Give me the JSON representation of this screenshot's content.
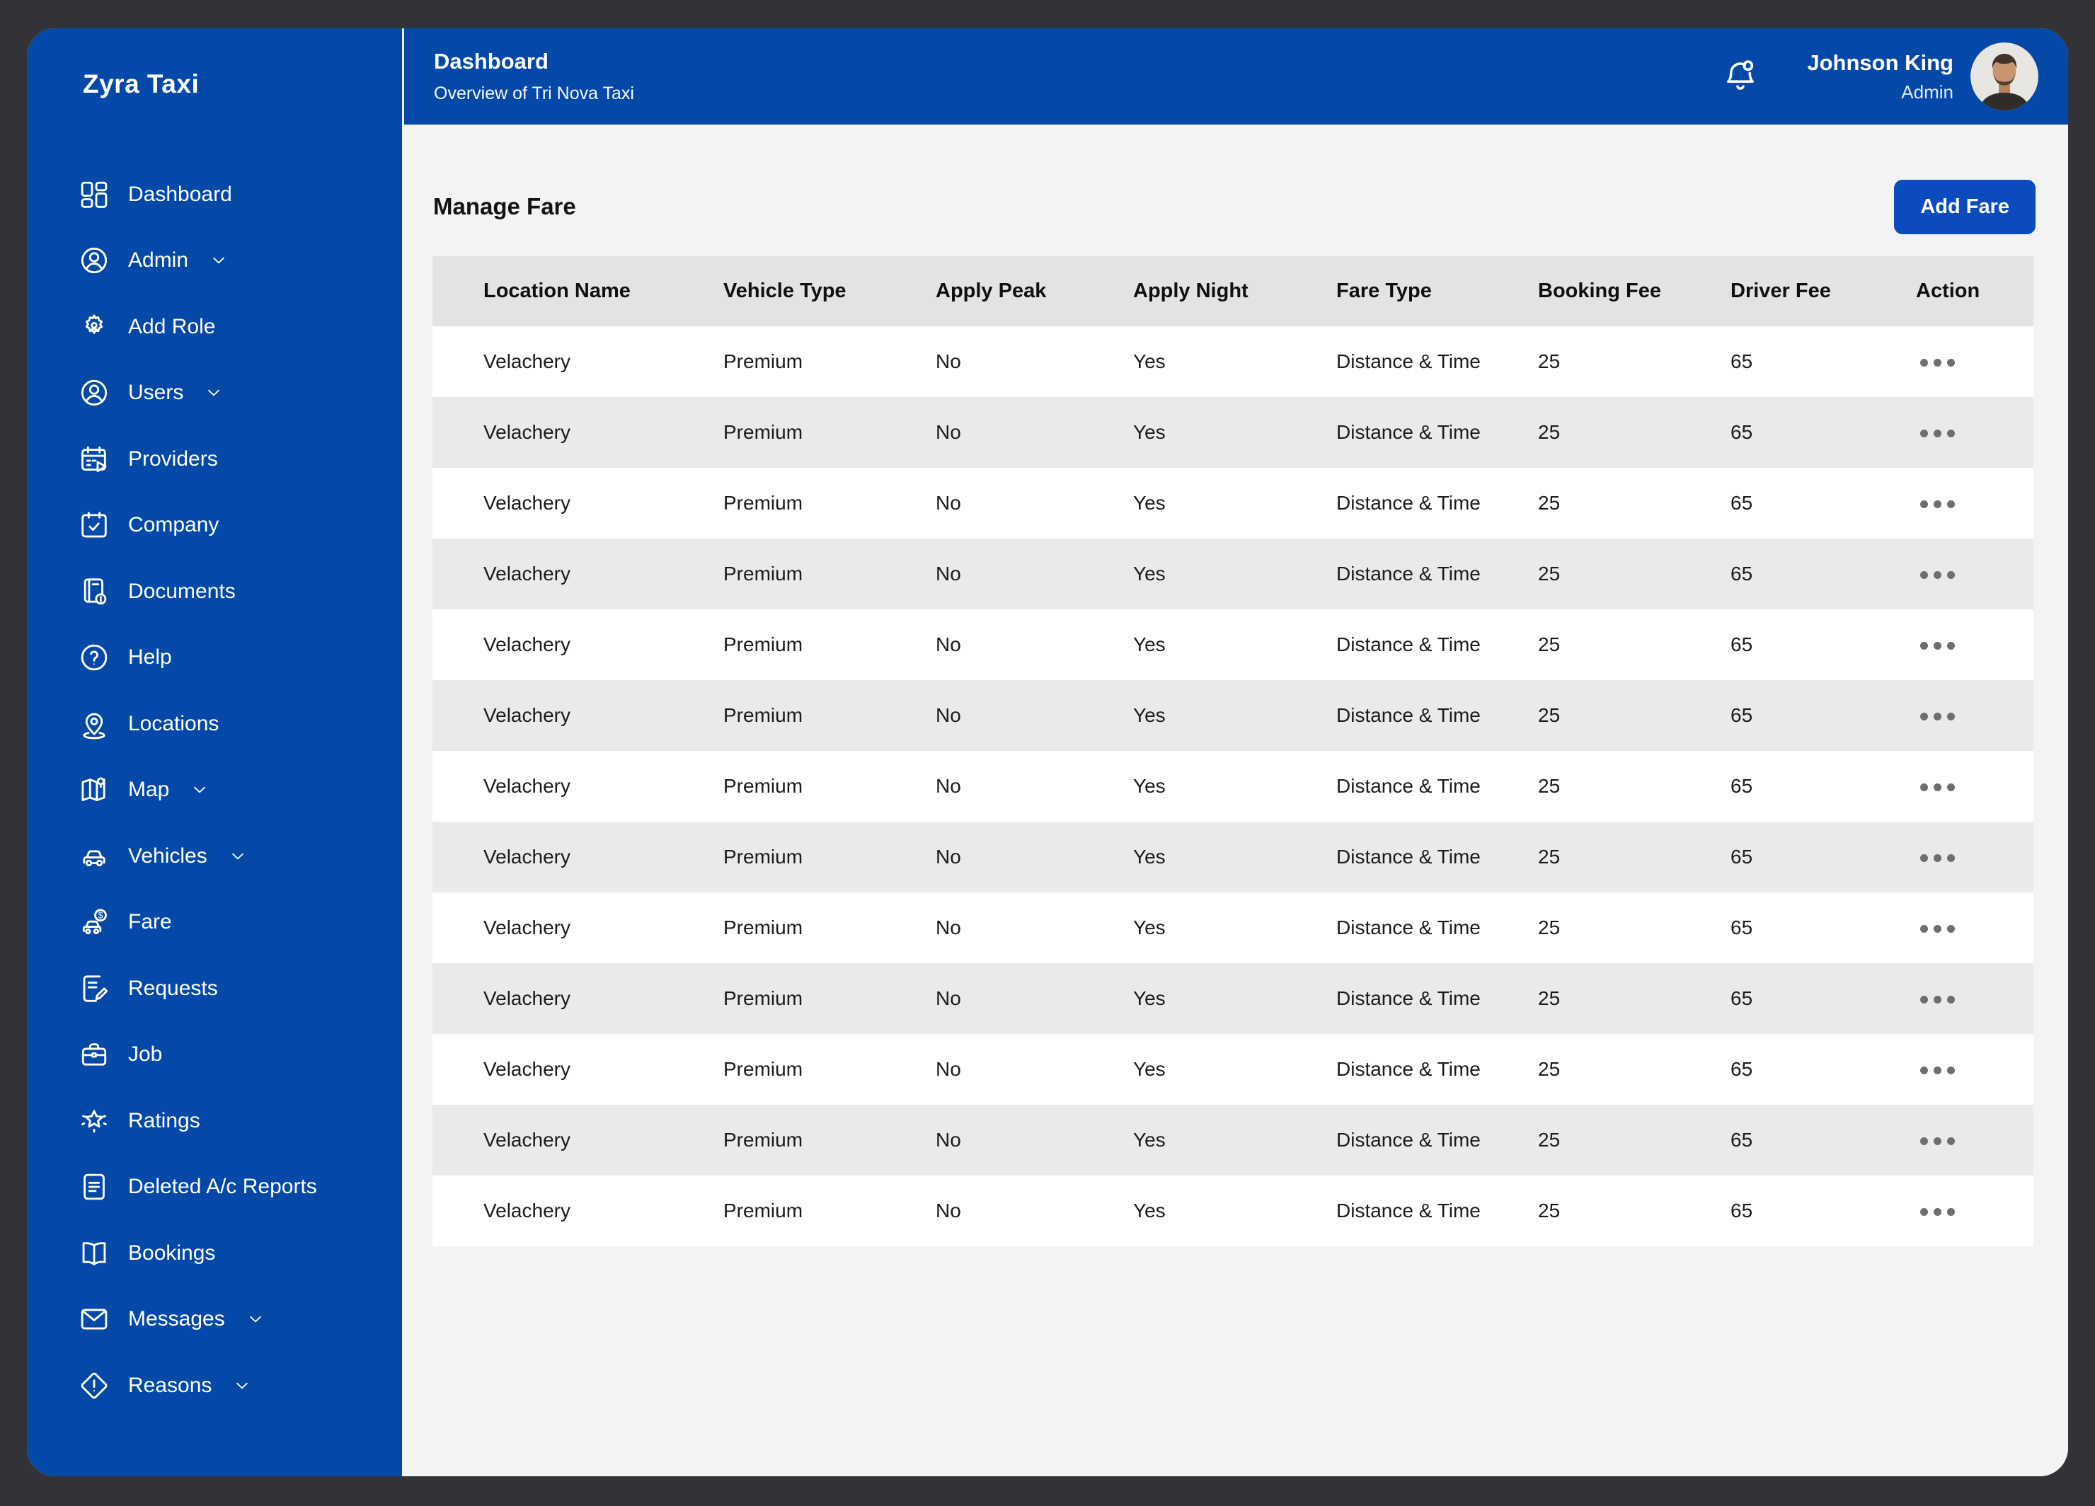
{
  "colors": {
    "accent": "#0449A8",
    "accent_button": "#0B4BBE",
    "frame": "#323336",
    "content_bg": "#F3F3F3",
    "table_header_bg": "#E3E3E3",
    "row_alt_bg": "#EAEAEA",
    "action_dots": "#6E6E6E"
  },
  "sidebar": {
    "brand": "Zyra Taxi",
    "items": [
      {
        "id": "dashboard",
        "label": "Dashboard",
        "icon": "dashboard",
        "expandable": false
      },
      {
        "id": "admin",
        "label": "Admin",
        "icon": "user",
        "expandable": true
      },
      {
        "id": "add-role",
        "label": "Add Role",
        "icon": "add-role",
        "expandable": false
      },
      {
        "id": "users",
        "label": "Users",
        "icon": "user",
        "expandable": true
      },
      {
        "id": "providers",
        "label": "Providers",
        "icon": "providers",
        "expandable": false
      },
      {
        "id": "company",
        "label": "Company",
        "icon": "company",
        "expandable": false
      },
      {
        "id": "documents",
        "label": "Documents",
        "icon": "documents",
        "expandable": false
      },
      {
        "id": "help",
        "label": "Help",
        "icon": "help",
        "expandable": false
      },
      {
        "id": "locations",
        "label": "Locations",
        "icon": "locations",
        "expandable": false
      },
      {
        "id": "map",
        "label": "Map",
        "icon": "map",
        "expandable": true
      },
      {
        "id": "vehicles",
        "label": "Vehicles",
        "icon": "vehicles",
        "expandable": true
      },
      {
        "id": "fare",
        "label": "Fare",
        "icon": "fare",
        "expandable": false
      },
      {
        "id": "requests",
        "label": "Requests",
        "icon": "requests",
        "expandable": false
      },
      {
        "id": "job",
        "label": "Job",
        "icon": "job",
        "expandable": false
      },
      {
        "id": "ratings",
        "label": "Ratings",
        "icon": "ratings",
        "expandable": false
      },
      {
        "id": "deleted-ac-reports",
        "label": "Deleted A/c Reports",
        "icon": "deleted-reports",
        "expandable": false
      },
      {
        "id": "bookings",
        "label": "Bookings",
        "icon": "bookings",
        "expandable": false
      },
      {
        "id": "messages",
        "label": "Messages",
        "icon": "messages",
        "expandable": true
      },
      {
        "id": "reasons",
        "label": "Reasons",
        "icon": "reasons",
        "expandable": true
      }
    ]
  },
  "header": {
    "title": "Dashboard",
    "subtitle": "Overview of Tri Nova Taxi",
    "user": {
      "name": "Johnson King",
      "role": "Admin"
    }
  },
  "main": {
    "heading": "Manage Fare",
    "add_button_label": "Add Fare",
    "table": {
      "columns": [
        {
          "key": "location",
          "label": "Location Name"
        },
        {
          "key": "vehicle",
          "label": "Vehicle Type"
        },
        {
          "key": "peak",
          "label": "Apply Peak"
        },
        {
          "key": "night",
          "label": "Apply Night"
        },
        {
          "key": "fare_type",
          "label": "Fare Type"
        },
        {
          "key": "booking",
          "label": "Booking Fee"
        },
        {
          "key": "driver",
          "label": "Driver Fee"
        },
        {
          "key": "action",
          "label": "Action"
        }
      ],
      "rows": [
        {
          "location": "Velachery",
          "vehicle": "Premium",
          "peak": "No",
          "night": "Yes",
          "fare_type": "Distance & Time",
          "booking": "25",
          "driver": "65"
        },
        {
          "location": "Velachery",
          "vehicle": "Premium",
          "peak": "No",
          "night": "Yes",
          "fare_type": "Distance & Time",
          "booking": "25",
          "driver": "65"
        },
        {
          "location": "Velachery",
          "vehicle": "Premium",
          "peak": "No",
          "night": "Yes",
          "fare_type": "Distance & Time",
          "booking": "25",
          "driver": "65"
        },
        {
          "location": "Velachery",
          "vehicle": "Premium",
          "peak": "No",
          "night": "Yes",
          "fare_type": "Distance & Time",
          "booking": "25",
          "driver": "65"
        },
        {
          "location": "Velachery",
          "vehicle": "Premium",
          "peak": "No",
          "night": "Yes",
          "fare_type": "Distance & Time",
          "booking": "25",
          "driver": "65"
        },
        {
          "location": "Velachery",
          "vehicle": "Premium",
          "peak": "No",
          "night": "Yes",
          "fare_type": "Distance & Time",
          "booking": "25",
          "driver": "65"
        },
        {
          "location": "Velachery",
          "vehicle": "Premium",
          "peak": "No",
          "night": "Yes",
          "fare_type": "Distance & Time",
          "booking": "25",
          "driver": "65"
        },
        {
          "location": "Velachery",
          "vehicle": "Premium",
          "peak": "No",
          "night": "Yes",
          "fare_type": "Distance & Time",
          "booking": "25",
          "driver": "65"
        },
        {
          "location": "Velachery",
          "vehicle": "Premium",
          "peak": "No",
          "night": "Yes",
          "fare_type": "Distance & Time",
          "booking": "25",
          "driver": "65"
        },
        {
          "location": "Velachery",
          "vehicle": "Premium",
          "peak": "No",
          "night": "Yes",
          "fare_type": "Distance & Time",
          "booking": "25",
          "driver": "65"
        },
        {
          "location": "Velachery",
          "vehicle": "Premium",
          "peak": "No",
          "night": "Yes",
          "fare_type": "Distance & Time",
          "booking": "25",
          "driver": "65"
        },
        {
          "location": "Velachery",
          "vehicle": "Premium",
          "peak": "No",
          "night": "Yes",
          "fare_type": "Distance & Time",
          "booking": "25",
          "driver": "65"
        },
        {
          "location": "Velachery",
          "vehicle": "Premium",
          "peak": "No",
          "night": "Yes",
          "fare_type": "Distance & Time",
          "booking": "25",
          "driver": "65"
        }
      ]
    }
  }
}
